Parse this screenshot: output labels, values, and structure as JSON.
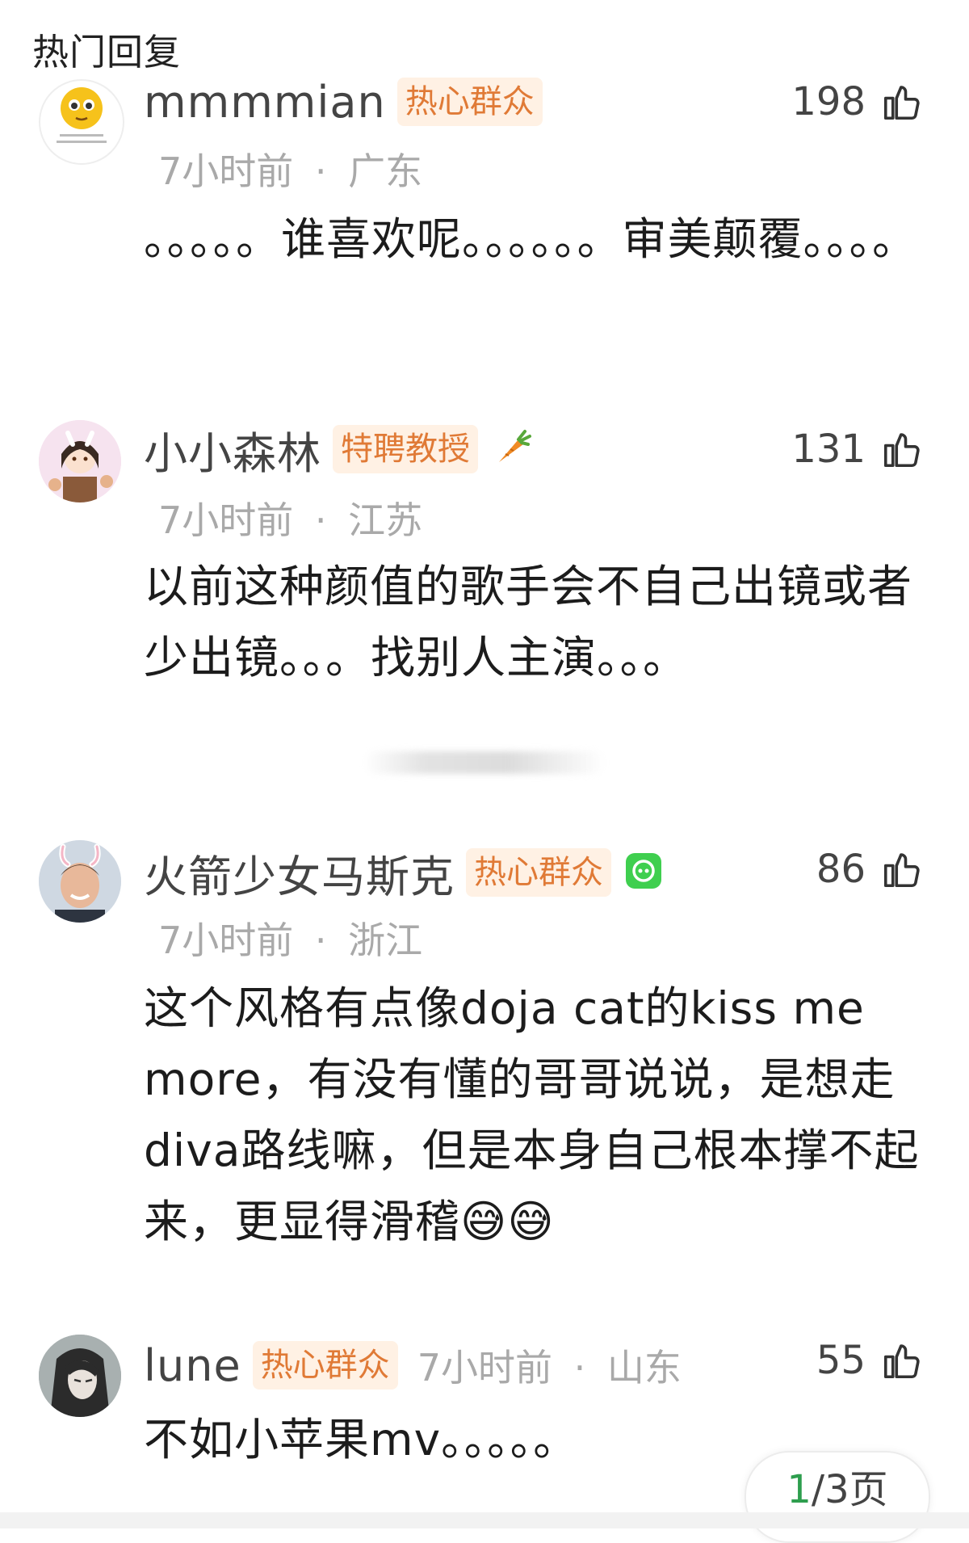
{
  "header": {
    "title": "热门回复"
  },
  "comments": [
    {
      "username": "mmmmian",
      "badge": "热心群众",
      "likes": "198",
      "time": "7小时前",
      "location": "广东",
      "meta_sep": "·",
      "text": "。。。。。谁喜欢呢。。。。。。审美颠覆。。。。"
    },
    {
      "username": "小小森林",
      "badge": "特聘教授",
      "extra_icon": "carrot-icon",
      "likes": "131",
      "time": "7小时前",
      "location": "江苏",
      "meta_sep": "·",
      "text": "以前这种颜值的歌手会不自己出镜或者少出镜。。。找别人主演。。。"
    },
    {
      "username": "火箭少女马斯克",
      "badge": "热心群众",
      "extra_icon": "green-app-icon",
      "likes": "86",
      "time": "7小时前",
      "location": "浙江",
      "meta_sep": "·",
      "text": "这个风格有点像doja cat的kiss me more，有没有懂的哥哥说说，是想走diva路线嘛，但是本身自己根本撑不起来，更显得滑稽😅😅"
    },
    {
      "username": "lune",
      "badge": "热心群众",
      "likes": "55",
      "time": "7小时前",
      "location": "山东",
      "meta_sep": "·",
      "text": "不如小苹果mv。。。。。"
    }
  ],
  "pager": {
    "current": "1",
    "rest": "/3页"
  },
  "colors": {
    "badge_text": "#e07a36",
    "badge_bg": "#fff1e4",
    "meta": "#a9a9a9",
    "pager_current": "#2e9e4e"
  }
}
